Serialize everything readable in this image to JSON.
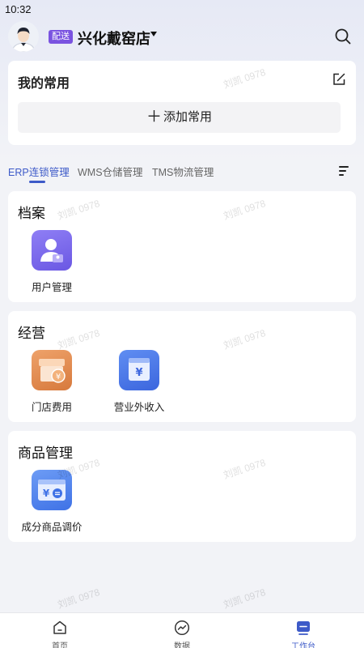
{
  "status_bar": {
    "time": "10:32"
  },
  "header": {
    "badge": "配送",
    "store_name": "兴化戴窑店",
    "icons": {
      "avatar": "user-avatar",
      "dropdown": "caret-down-icon",
      "search": "search-icon"
    }
  },
  "favorites": {
    "title": "我的常用",
    "add_label": "添加常用",
    "icons": {
      "edit": "edit-icon",
      "add": "plus-icon"
    }
  },
  "tabs": [
    {
      "label": "ERP连锁管理",
      "active": true
    },
    {
      "label": "WMS仓储管理",
      "active": false
    },
    {
      "label": "TMS物流管理",
      "active": false
    }
  ],
  "sections": [
    {
      "title": "档案",
      "apps": [
        {
          "label": "用户管理",
          "icon": "user-manage-icon",
          "color": "#7c6cf0"
        }
      ]
    },
    {
      "title": "经营",
      "apps": [
        {
          "label": "门店费用",
          "icon": "store-fee-icon",
          "color": "#e08a4a"
        },
        {
          "label": "营业外收入",
          "icon": "wallet-yuan-icon",
          "color": "#4a79ec"
        }
      ]
    },
    {
      "title": "商品管理",
      "apps": [
        {
          "label": "成分商品调价",
          "icon": "price-adjust-icon",
          "color": "#4f83ee"
        }
      ]
    }
  ],
  "watermark": "刘凯 0978",
  "tabbar": [
    {
      "label": "首页",
      "icon": "home-icon",
      "active": false
    },
    {
      "label": "数据",
      "icon": "chart-icon",
      "active": false
    },
    {
      "label": "工作台",
      "icon": "workbench-icon",
      "active": true
    }
  ],
  "colors": {
    "accent": "#3d5ac8",
    "badge": "#7a53e0",
    "background": "#f2f3f7"
  }
}
